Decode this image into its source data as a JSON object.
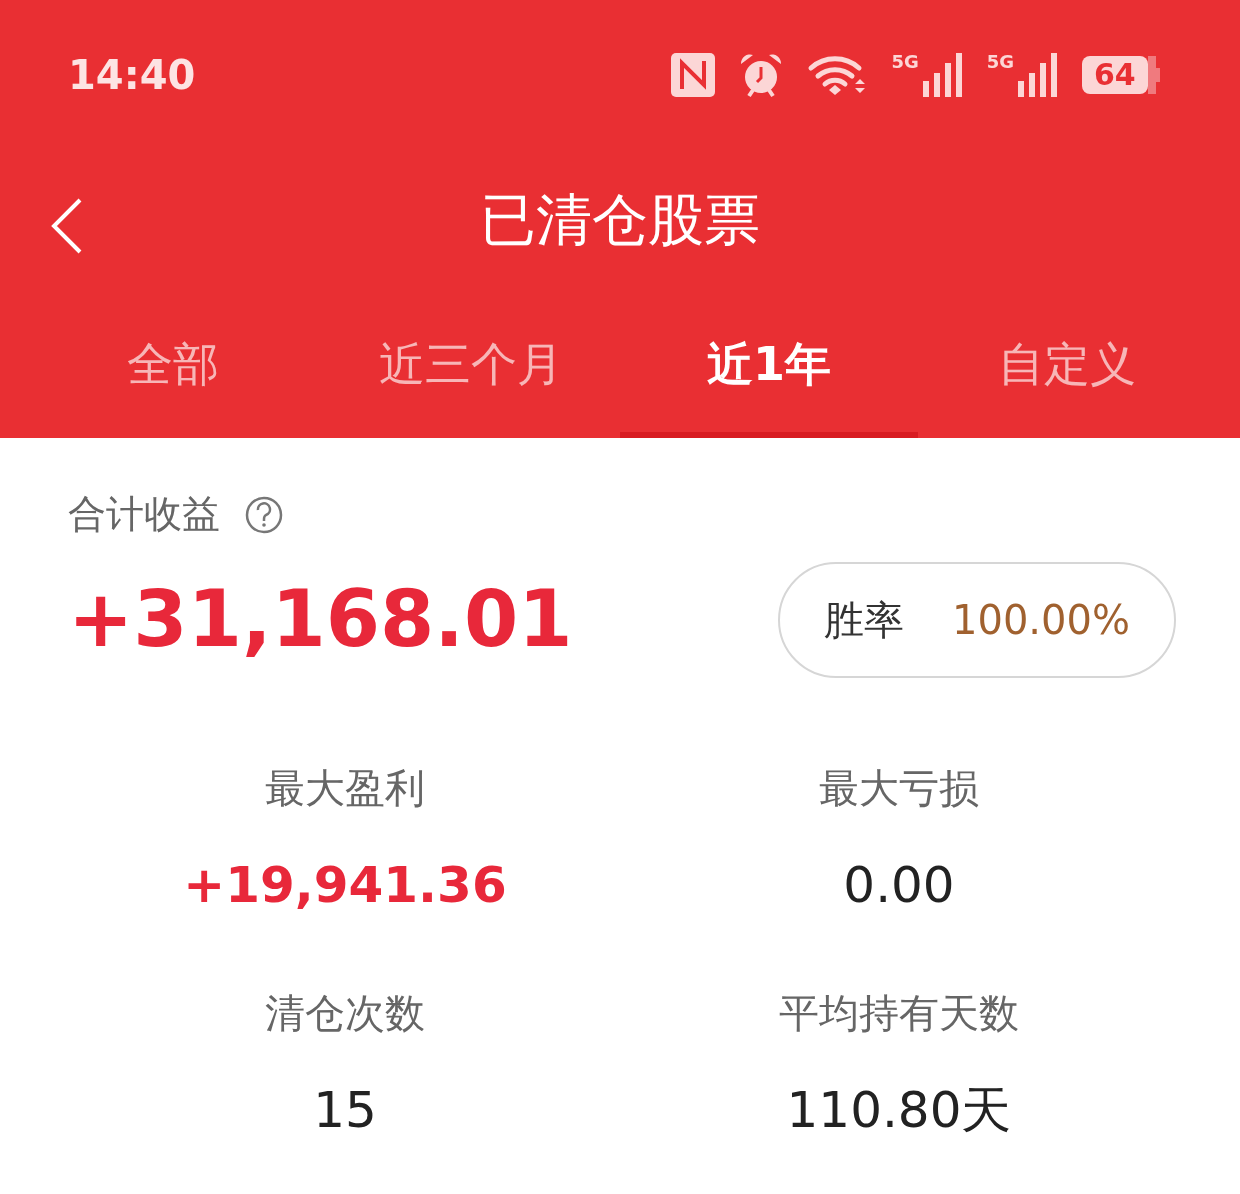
{
  "status_bar": {
    "time": "14:40",
    "network_labels": [
      "5G",
      "5G"
    ],
    "battery": "64"
  },
  "header": {
    "title": "已清仓股票"
  },
  "tabs": [
    {
      "label": "全部",
      "selected": false
    },
    {
      "label": "近三个月",
      "selected": false
    },
    {
      "label": "近1年",
      "selected": true
    },
    {
      "label": "自定义",
      "selected": false
    }
  ],
  "summary": {
    "label": "合计收益",
    "total": "+31,168.01",
    "win_rate": {
      "label": "胜率",
      "value": "100.00%"
    }
  },
  "stats": [
    {
      "label": "最大盈利",
      "value": "+19,941.36",
      "kind": "gain"
    },
    {
      "label": "最大亏损",
      "value": "0.00",
      "kind": "neutral"
    },
    {
      "label": "清仓次数",
      "value": "15",
      "kind": "neutral"
    },
    {
      "label": "平均持有天数",
      "value": "110.80天",
      "kind": "neutral"
    }
  ]
}
